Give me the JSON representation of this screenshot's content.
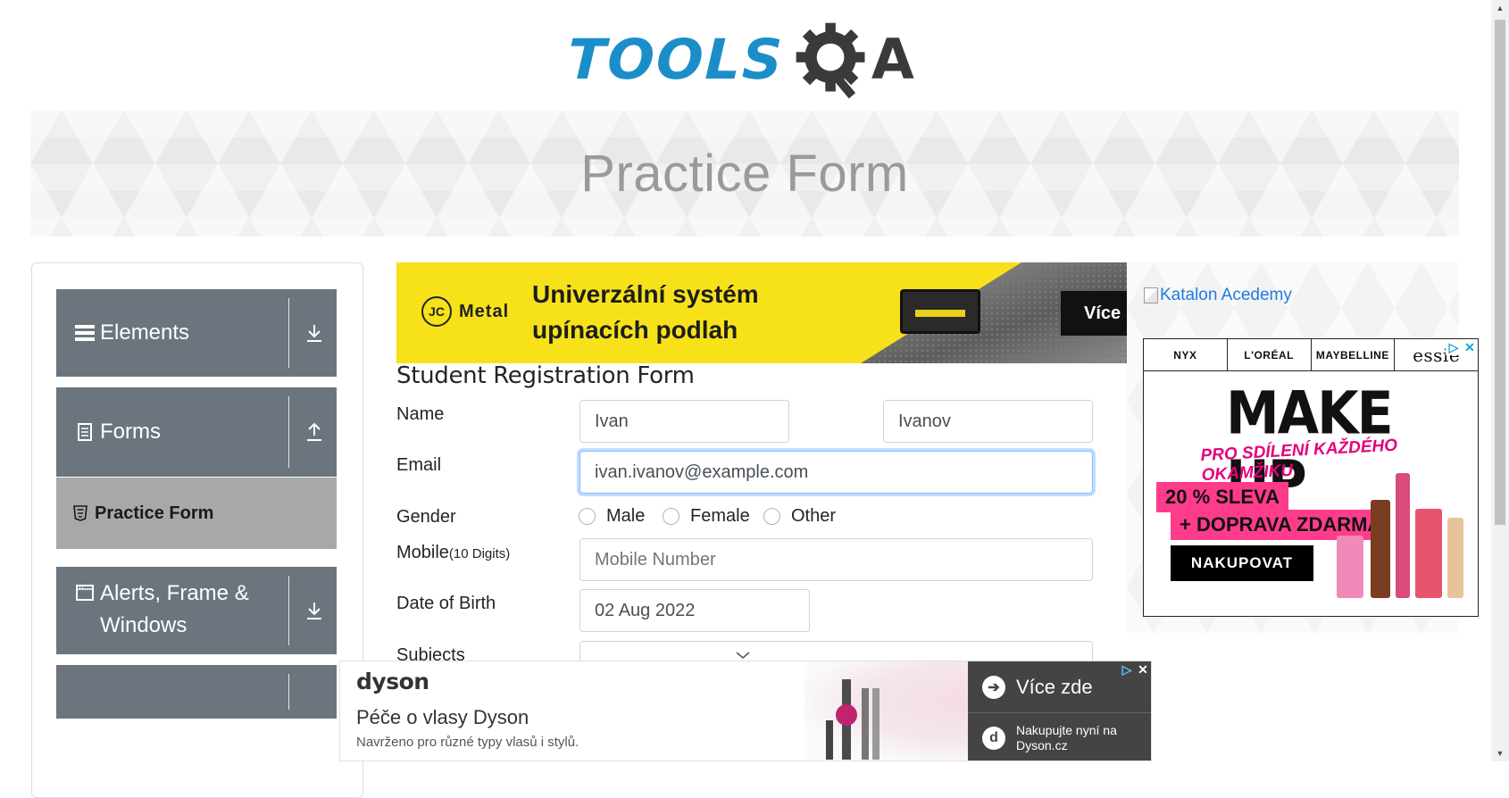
{
  "logo": {
    "text": "TOOLS",
    "suffix": "A"
  },
  "banner": {
    "title": "Practice Form"
  },
  "sidebar": {
    "groups": [
      {
        "label": "Elements",
        "icon": "hamburger-icon",
        "arrow": "download-arrow-icon"
      },
      {
        "label": "Forms",
        "icon": "document-icon",
        "arrow": "upload-arrow-icon"
      },
      {
        "label": "Alerts, Frame & Windows",
        "icon": "window-icon",
        "arrow": "download-arrow-icon"
      }
    ],
    "active_item": {
      "label": "Practice Form",
      "icon": "html5-icon"
    }
  },
  "ads": {
    "top": {
      "brand_circle": "JC",
      "brand": "Metal",
      "headline_line1": "Univerzální systém",
      "headline_line2": "upínacích podlah",
      "cta": "Více i"
    },
    "right": {
      "link_text": "Katalon Acedemy",
      "brands": [
        "NYX",
        "L'ORÉAL",
        "MAYBELLINE",
        "essie"
      ],
      "headline": "MAKE UP",
      "tagline": "PRO SDÍLENÍ KAŽDÉHO OKAMŽIKU",
      "sale_line1": "20 % SLEVA",
      "sale_line2": "+ DOPRAVA ZDARMA",
      "cta": "NAKUPOVAT"
    },
    "bottom": {
      "brand": "dyson",
      "title": "Péče o vlasy Dyson",
      "subtitle": "Navrženo pro různé typy vlasů i stylů.",
      "cta_primary": "Více zde",
      "cta_secondary_line1": "Nakupujte nyní na",
      "cta_secondary_line2": "Dyson.cz",
      "cta_secondary_icon_letter": "d"
    }
  },
  "form": {
    "title": "Student Registration Form",
    "name_label": "Name",
    "first_name": "Ivan",
    "last_name": "Ivanov",
    "email_label": "Email",
    "email": "ivan.ivanov@example.com",
    "gender_label": "Gender",
    "gender_options": [
      "Male",
      "Female",
      "Other"
    ],
    "mobile_label": "Mobile",
    "mobile_hint": "(10 Digits)",
    "mobile_placeholder": "Mobile Number",
    "dob_label": "Date of Birth",
    "dob": "02 Aug 2022",
    "subjects_label": "Subjects"
  },
  "colors": {
    "brand_blue": "#1b8ec9",
    "sidebar_gray": "#6c757d",
    "active_item_gray": "#a8a8a8",
    "focus_blue": "#80bdff",
    "link_blue": "#1f7be0",
    "ad_yellow": "#f7e21a",
    "ad_pink": "#ff3c8c"
  }
}
